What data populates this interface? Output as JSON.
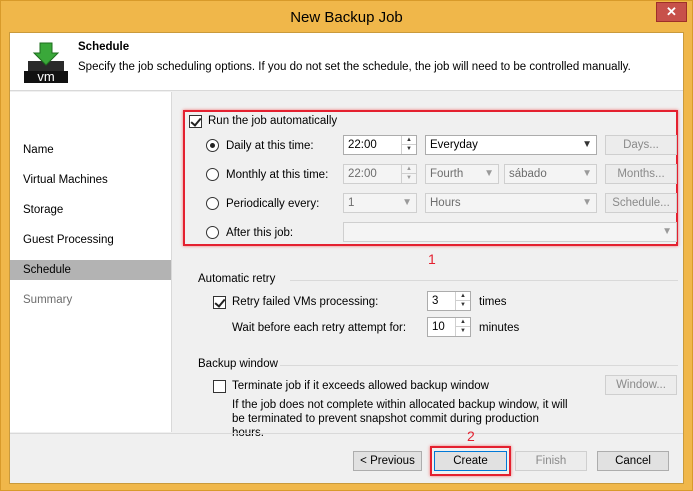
{
  "window": {
    "title": "New Backup Job",
    "close_label": "✕"
  },
  "header": {
    "title": "Schedule",
    "description": "Specify the job scheduling options. If you do not set the schedule, the job will need to be controlled manually.",
    "icon_text": "vm"
  },
  "nav": {
    "items": [
      {
        "label": "Name"
      },
      {
        "label": "Virtual Machines"
      },
      {
        "label": "Storage"
      },
      {
        "label": "Guest Processing"
      },
      {
        "label": "Schedule"
      },
      {
        "label": "Summary"
      }
    ]
  },
  "schedule": {
    "run_auto_label": "Run the job automatically",
    "daily": {
      "label": "Daily at this time:",
      "time": "22:00",
      "days": "Everyday",
      "button": "Days..."
    },
    "monthly": {
      "label": "Monthly at this time:",
      "time": "22:00",
      "week": "Fourth",
      "day": "sábado",
      "button": "Months..."
    },
    "periodic": {
      "label": "Periodically every:",
      "value": "1",
      "unit": "Hours",
      "button": "Schedule..."
    },
    "after": {
      "label": "After this job:",
      "value": ""
    },
    "annotation": "1"
  },
  "retry": {
    "group_label": "Automatic retry",
    "retry_label": "Retry failed VMs processing:",
    "retry_count": "3",
    "retry_unit": "times",
    "wait_label": "Wait before each retry attempt for:",
    "wait_value": "10",
    "wait_unit": "minutes"
  },
  "backup_window": {
    "group_label": "Backup window",
    "terminate_label": "Terminate job if it exceeds allowed backup window",
    "window_button": "Window...",
    "note": "If the job does not complete within allocated backup window, it will be terminated to prevent snapshot commit during production hours."
  },
  "footer": {
    "previous": "< Previous",
    "create": "Create",
    "finish": "Finish",
    "cancel": "Cancel",
    "annotation": "2"
  },
  "colors": {
    "highlight": "#e4202f",
    "titlebar": "#f0b74a",
    "selected_nav": "#b3b3b3"
  }
}
